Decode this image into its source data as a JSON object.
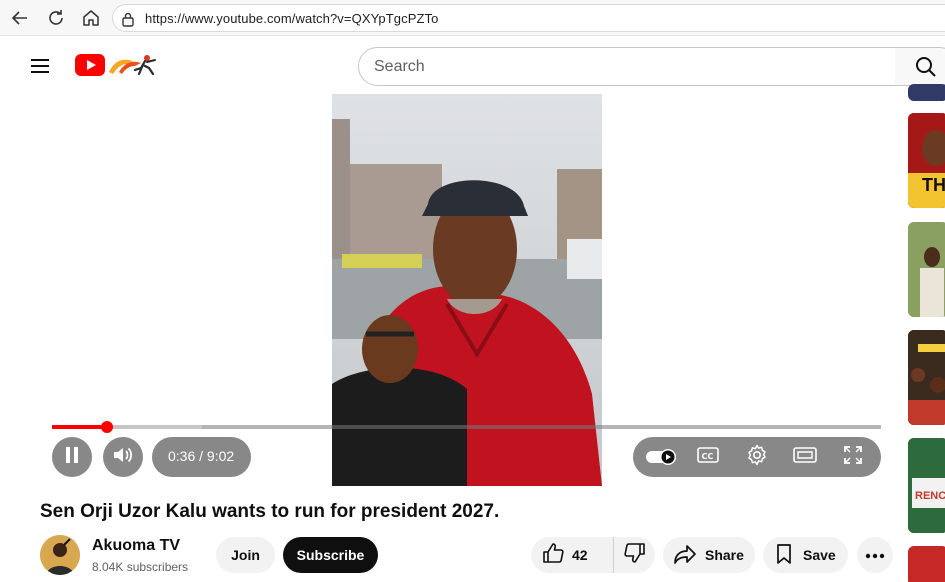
{
  "browser": {
    "url": "https://www.youtube.com/watch?v=QXYpTgcPZTo"
  },
  "header": {
    "search_placeholder": "Search"
  },
  "player": {
    "time_display": "0:36 / 9:02",
    "progress_fraction": 0.066,
    "playing": true
  },
  "video": {
    "title": "Sen Orji Uzor Kalu wants to run for president 2027."
  },
  "channel": {
    "name": "Akuoma TV",
    "subscribers": "8.04K subscribers",
    "join_label": "Join",
    "subscribe_label": "Subscribe"
  },
  "actions": {
    "like_count": "42",
    "share_label": "Share",
    "save_label": "Save"
  },
  "sidebar": {
    "thumbnails": [
      {
        "caption": ""
      },
      {
        "caption": "TH"
      },
      {
        "caption": ""
      },
      {
        "caption": ""
      },
      {
        "caption": "RENC"
      },
      {
        "caption": ""
      }
    ]
  },
  "colors": {
    "accent_red": "#ff0000",
    "subscribe_bg": "#0f0f0f",
    "pill_bg": "#f2f2f2"
  }
}
